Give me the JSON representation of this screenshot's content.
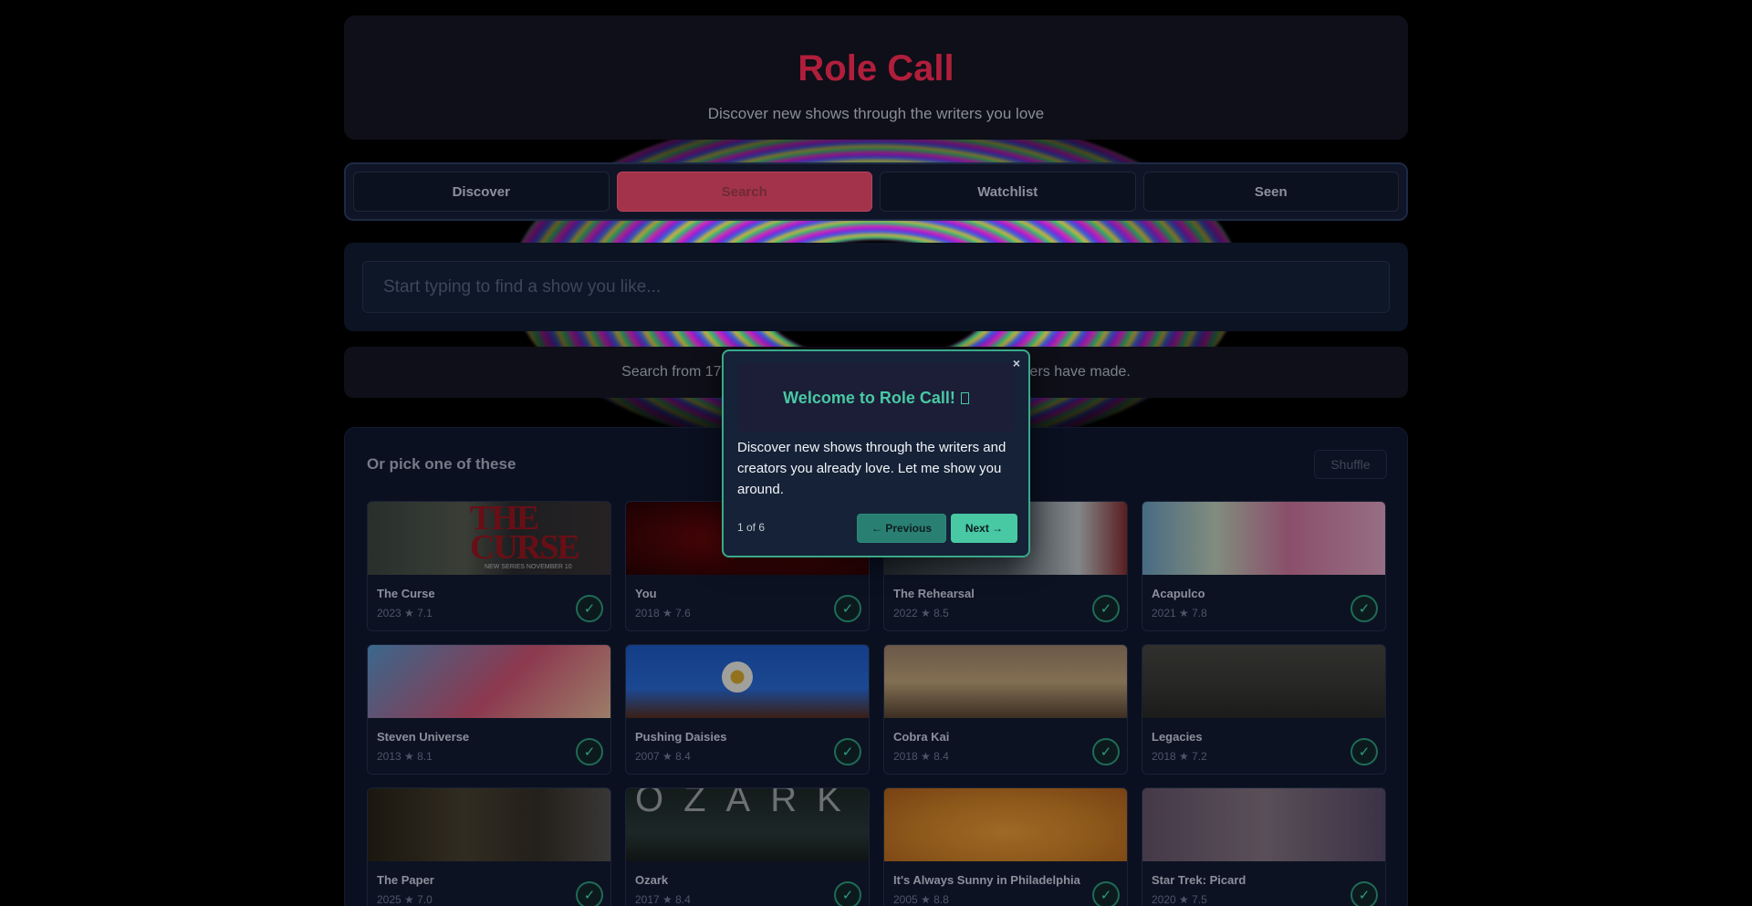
{
  "header": {
    "title": "Role Call",
    "subtitle": "Discover new shows through the writers you love"
  },
  "tabs": [
    {
      "label": "Discover",
      "active": false
    },
    {
      "label": "Search",
      "active": true
    },
    {
      "label": "Watchlist",
      "active": false
    },
    {
      "label": "Seen",
      "active": false
    }
  ],
  "search": {
    "placeholder": "Start typing to find a show you like..."
  },
  "info": {
    "text_left": "Search from 17",
    "text_right": "ers have made."
  },
  "picks": {
    "title": "Or pick one of these",
    "shuffle_label": "Shuffle",
    "shows": [
      {
        "title": "The Curse",
        "meta": "2023 ★ 7.1",
        "poster": "p-curse",
        "poster_text": "THE CURSE",
        "poster_sub": "NEW SERIES NOVEMBER 10"
      },
      {
        "title": "You",
        "meta": "2018 ★ 7.6",
        "poster": "p-you"
      },
      {
        "title": "The Rehearsal",
        "meta": "2022 ★ 8.5",
        "poster": "p-rehearsal"
      },
      {
        "title": "Acapulco",
        "meta": "2021 ★ 7.8",
        "poster": "p-acapulco"
      },
      {
        "title": "Steven Universe",
        "meta": "2013 ★ 8.1",
        "poster": "p-steven"
      },
      {
        "title": "Pushing Daisies",
        "meta": "2007 ★ 8.4",
        "poster": "p-daisies"
      },
      {
        "title": "Cobra Kai",
        "meta": "2018 ★ 8.4",
        "poster": "p-cobra"
      },
      {
        "title": "Legacies",
        "meta": "2018 ★ 7.2",
        "poster": "p-legacies"
      },
      {
        "title": "The Paper",
        "meta": "2025 ★ 7.0",
        "poster": "p-paper"
      },
      {
        "title": "Ozark",
        "meta": "2017 ★ 8.4",
        "poster": "p-ozark",
        "poster_text": "OZARK"
      },
      {
        "title": "It's Always Sunny in Philadelphia",
        "meta": "2005 ★ 8.8",
        "poster": "p-sunny"
      },
      {
        "title": "Star Trek: Picard",
        "meta": "2020 ★ 7.5",
        "poster": "p-picard"
      }
    ],
    "check_glyph": "✓"
  },
  "modal": {
    "close_glyph": "×",
    "title": "Welcome to Role Call!",
    "body": "Discover new shows through the writers and creators you already love. Let me show you around.",
    "step": "1 of 6",
    "prev_label": "← Previous",
    "next_label": "Next →"
  },
  "colors": {
    "brand": "#b01e3c",
    "accent": "#48c9a4",
    "active_tab": "#a3334a"
  }
}
